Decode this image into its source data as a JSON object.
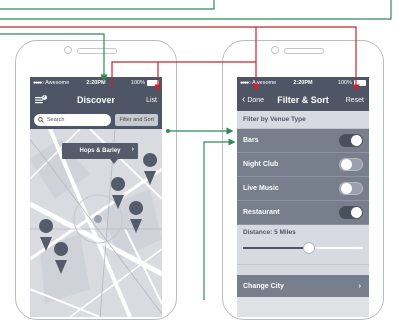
{
  "colors": {
    "navbar": "#4e5564",
    "row": "#777e8c",
    "section": "#d7dae0",
    "red_line": "#c4262e",
    "green_line": "#2e8b57"
  },
  "discover_screen": {
    "status": {
      "carrier": "Awesome",
      "time": "2:20PM",
      "battery": "100%"
    },
    "nav": {
      "menu_icon": "menu-icon",
      "badge": "2",
      "title": "Discover",
      "right": "List"
    },
    "search": {
      "placeholder": "Search",
      "filter_button": "Filter and Sort"
    },
    "map": {
      "callout": "Hops & Barley"
    }
  },
  "filter_screen": {
    "status": {
      "carrier": "Awesome",
      "time": "2:20PM",
      "battery": "100%"
    },
    "nav": {
      "back": "Done",
      "title": "Filter & Sort",
      "right": "Reset"
    },
    "section_title": "Filter by Venue Type",
    "rows": [
      {
        "label": "Bars",
        "on": true
      },
      {
        "label": "Night Club",
        "on": false
      },
      {
        "label": "Live Music",
        "on": false
      },
      {
        "label": "Restaurant",
        "on": true
      }
    ],
    "distance": {
      "label": "Distance: 5 Miles",
      "fraction": 0.55
    },
    "change_city": "Change City"
  }
}
